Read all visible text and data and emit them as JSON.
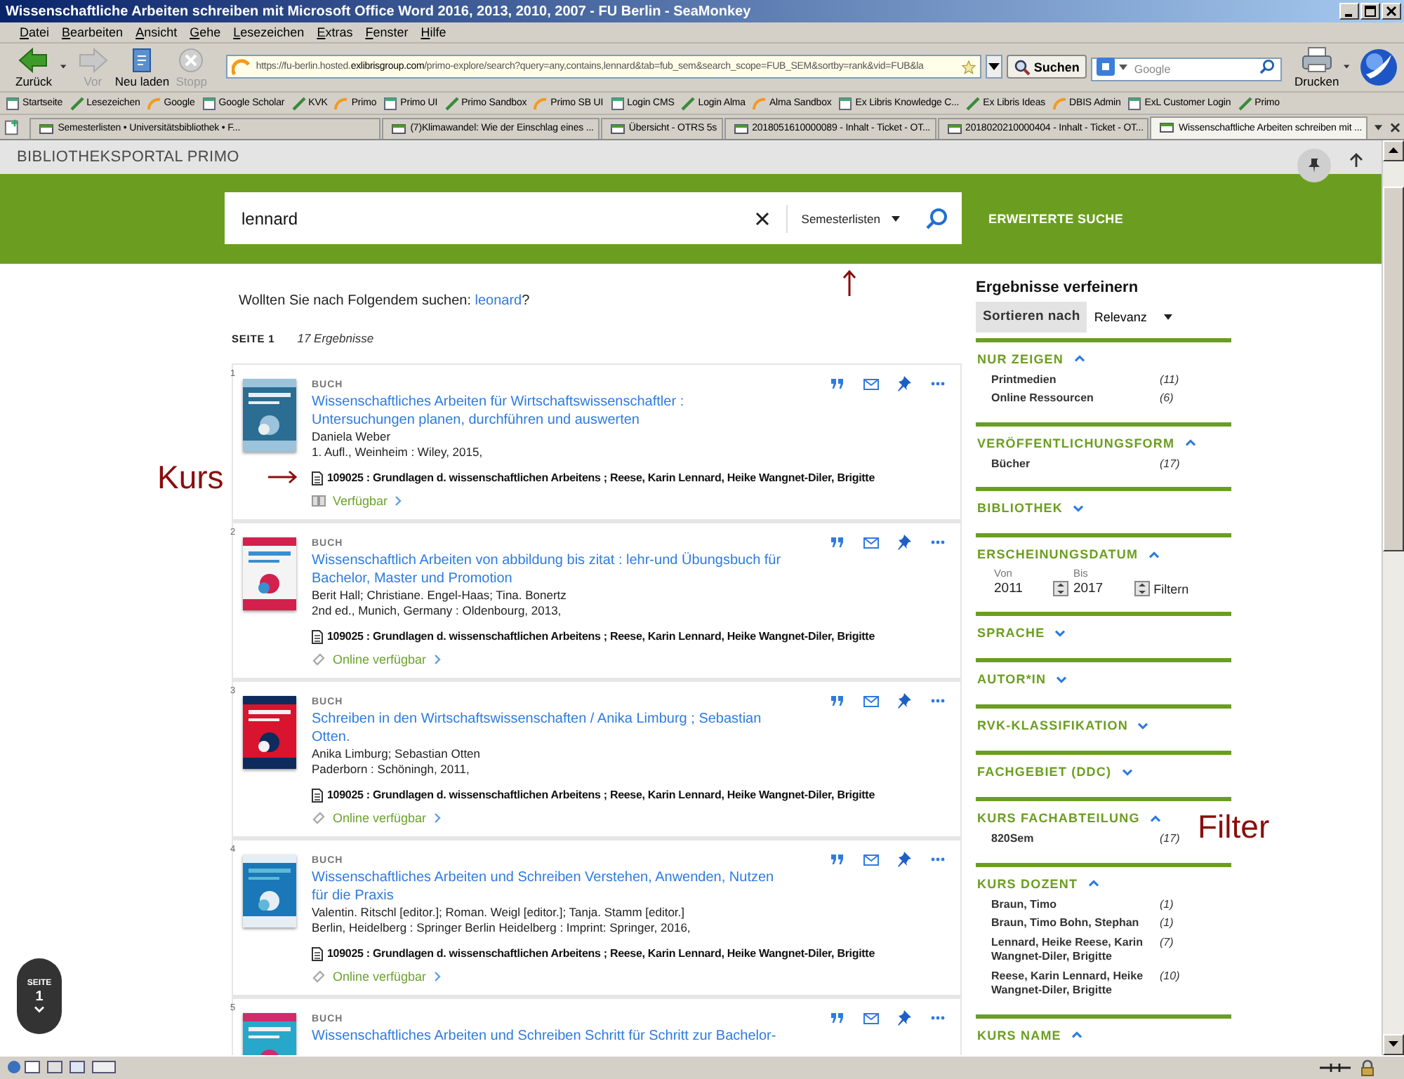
{
  "window": {
    "title": "Wissenschaftliche Arbeiten schreiben mit Microsoft Office Word 2016, 2013, 2010, 2007 - FU Berlin - SeaMonkey"
  },
  "menu": [
    "Datei",
    "Bearbeiten",
    "Ansicht",
    "Gehe",
    "Lesezeichen",
    "Extras",
    "Fenster",
    "Hilfe"
  ],
  "toolbar": {
    "buttons": [
      {
        "label": "Zurück",
        "disabled": false
      },
      {
        "label": "Vor",
        "disabled": true
      },
      {
        "label": "Neu laden",
        "disabled": false
      },
      {
        "label": "Stopp",
        "disabled": true
      }
    ],
    "url": "https://fu-berlin.hosted.**exlibrisgroup.com**/primo-explore/search?query=any,contains,lennard&tab=fub_sem&search_scope=FUB_SEM&sortby=rank&vid=FUB&la",
    "search_button": "Suchen",
    "search_placeholder": "Google",
    "print": "Drucken"
  },
  "bookmarks": [
    "Startseite",
    "Lesezeichen",
    "Google",
    "Google Scholar",
    "KVK",
    "Primo",
    "Primo UI",
    "Primo Sandbox",
    "Primo SB UI",
    "Login CMS",
    "Login Alma",
    "Alma Sandbox",
    "Ex Libris Knowledge C...",
    "Ex Libris Ideas",
    "DBIS Admin",
    "ExL Customer Login",
    "Primo"
  ],
  "tabs": [
    {
      "label": "Semesterlisten • Universitätsbibliothek • F...",
      "selected": false
    },
    {
      "label": "(7)Klimawandel: Wie der Einschlag eines ...",
      "selected": false
    },
    {
      "label": "Übersicht - OTRS 5s",
      "selected": false
    },
    {
      "label": "2018051610000089 - Inhalt - Ticket - OT...",
      "selected": false
    },
    {
      "label": "2018020210000404 - Inhalt - Ticket - OT...",
      "selected": false
    },
    {
      "label": "Wissenschaftliche Arbeiten schreiben mit ...",
      "selected": true
    }
  ],
  "page": {
    "header": "BIBLIOTHEKSPORTAL PRIMO",
    "search": {
      "value": "lennard",
      "scope": "Semesterlisten",
      "advanced": "ERWEITERTE SUCHE"
    },
    "suggestion": {
      "text": "Wollten Sie nach Folgendem suchen:",
      "link": "leonard",
      "tail": "?"
    },
    "page_label": "SEITE 1",
    "count": "17 Ergebnisse",
    "results": [
      {
        "number": "1",
        "type": "BUCH",
        "title": "Wissenschaftliches Arbeiten für Wirtschaftswissenschaftler : Untersuchungen planen, durchführen und auswerten",
        "authors": "Daniela Weber",
        "publication": "1. Aufl., Weinheim : Wiley, 2015,",
        "course": "109025 : Grundlagen d. wissenschaftlichen Arbeitens ; Reese, Karin Lennard, Heike Wangnet-Diler, Brigitte",
        "availability": {
          "kind": "print",
          "label": "Verfügbar"
        }
      },
      {
        "number": "2",
        "type": "BUCH",
        "title": "Wissenschaftlich Arbeiten von abbildung bis zitat : lehr-und Übungsbuch für Bachelor, Master und Promotion",
        "authors": "Berit Hall; Christiane. Engel-Haas; Tina. Bonertz",
        "publication": "2nd ed., Munich, Germany : Oldenbourg, 2013,",
        "course": "109025 : Grundlagen d. wissenschaftlichen Arbeitens ; Reese, Karin Lennard, Heike Wangnet-Diler, Brigitte",
        "availability": {
          "kind": "online",
          "label": "Online verfügbar"
        }
      },
      {
        "number": "3",
        "type": "BUCH",
        "title": "Schreiben in den Wirtschaftswissenschaften / Anika Limburg ; Sebastian Otten.",
        "authors": "Anika Limburg; Sebastian Otten",
        "publication": "Paderborn : Schöningh, 2011,",
        "course": "109025 : Grundlagen d. wissenschaftlichen Arbeitens ; Reese, Karin Lennard, Heike Wangnet-Diler, Brigitte",
        "availability": {
          "kind": "online",
          "label": "Online verfügbar"
        }
      },
      {
        "number": "4",
        "type": "BUCH",
        "title": "Wissenschaftliches Arbeiten und Schreiben Verstehen, Anwenden, Nutzen für die Praxis",
        "authors": "Valentin. Ritschl [editor.]; Roman. Weigl [editor.]; Tanja. Stamm [editor.]",
        "publication": "Berlin, Heidelberg : Springer Berlin Heidelberg : Imprint: Springer, 2016,",
        "course": "109025 : Grundlagen d. wissenschaftlichen Arbeitens ; Reese, Karin Lennard, Heike Wangnet-Diler, Brigitte",
        "availability": {
          "kind": "online",
          "label": "Online verfügbar"
        }
      },
      {
        "number": "5",
        "type": "BUCH",
        "title": "Wissenschaftliches Arbeiten und Schreiben Schritt für Schritt zur Bachelor-"
      }
    ],
    "refine": {
      "title": "Ergebnisse verfeinern",
      "sort_label": "Sortieren nach",
      "sort_value": "Relevanz",
      "sections": [
        {
          "kind": "list",
          "title": "NUR ZEIGEN",
          "expanded": true,
          "items": [
            {
              "label": "Printmedien",
              "count": "(11)"
            },
            {
              "label": "Online Ressourcen",
              "count": "(6)"
            }
          ]
        },
        {
          "kind": "list",
          "title": "VERÖFFENTLICHUNGSFORM",
          "expanded": true,
          "items": [
            {
              "label": "Bücher",
              "count": "(17)"
            }
          ]
        },
        {
          "title": "BIBLIOTHEK",
          "expanded": false
        },
        {
          "kind": "date",
          "title": "ERSCHEINUNGSDATUM",
          "expanded": true,
          "from_label": "Von",
          "from": "2011",
          "to_label": "Bis",
          "to": "2017",
          "filter": "Filtern"
        },
        {
          "title": "SPRACHE",
          "expanded": false
        },
        {
          "title": "AUTOR*IN",
          "expanded": false
        },
        {
          "title": "RVK-KLASSIFIKATION",
          "expanded": false
        },
        {
          "title": "FACHGEBIET (DDC)",
          "expanded": false
        },
        {
          "kind": "list",
          "title": "KURS FACHABTEILUNG",
          "expanded": true,
          "items": [
            {
              "label": "820Sem",
              "count": "(17)"
            }
          ]
        },
        {
          "kind": "list",
          "title": "KURS DOZENT",
          "expanded": true,
          "items": [
            {
              "label": "Braun, Timo",
              "count": "(1)"
            },
            {
              "label": "Braun, Timo Bohn, Stephan",
              "count": "(1)"
            },
            {
              "label": "Lennard, Heike Reese, Karin Wangnet-Diler, Brigitte",
              "count": "(7)"
            },
            {
              "label": "Reese, Karin Lennard, Heike Wangnet-Diler, Brigitte",
              "count": "(10)"
            }
          ]
        },
        {
          "title": "KURS NAME",
          "expanded": true
        }
      ]
    },
    "page_badge": {
      "label": "SEITE",
      "value": "1"
    },
    "annotations": [
      {
        "text": "Kurs"
      },
      {
        "text": "Filter"
      }
    ]
  }
}
